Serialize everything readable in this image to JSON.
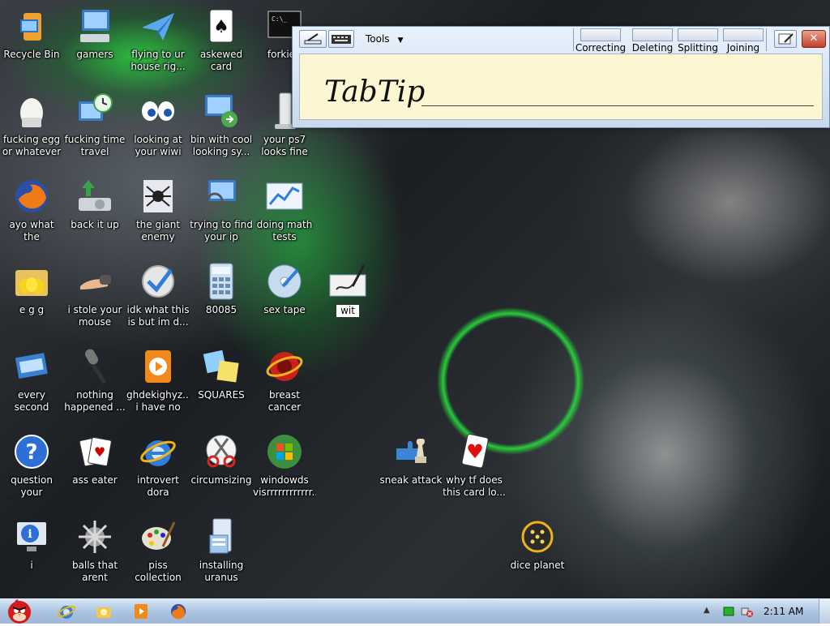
{
  "desktop": {
    "icons": [
      {
        "id": "recycle-bin",
        "label": "Recycle Bin",
        "icon": "recycle-bin-icon"
      },
      {
        "id": "gamers",
        "label": "gamers",
        "icon": "monitor-keyboard-icon"
      },
      {
        "id": "flying",
        "label": "flying to ur\nhouse rig...",
        "icon": "paper-plane-icon"
      },
      {
        "id": "askewed-card",
        "label": "askewed card\nhumping t...",
        "icon": "spade-card-icon"
      },
      {
        "id": "forkie",
        "label": "forkie f",
        "icon": "command-prompt-icon"
      },
      {
        "id": "egg",
        "label": "fucking egg\nor whatever",
        "icon": "egg-icon"
      },
      {
        "id": "time-travel",
        "label": "fucking time\ntravel",
        "icon": "clock-monitor-icon"
      },
      {
        "id": "wiwi",
        "label": "looking at\nyour wiwi",
        "icon": "eyes-icon"
      },
      {
        "id": "bin-cool",
        "label": "bin with cool\nlooking sy...",
        "icon": "network-monitor-icon"
      },
      {
        "id": "ps7",
        "label": "your ps7\nlooks fine",
        "icon": "console-icon"
      },
      {
        "id": "fox",
        "label": "ayo what the\nfox doing t...",
        "icon": "firefox-icon"
      },
      {
        "id": "back-it-up",
        "label": "back it up",
        "icon": "backup-icon"
      },
      {
        "id": "spider",
        "label": "the giant\nenemy spider",
        "icon": "spider-icon"
      },
      {
        "id": "ip",
        "label": "trying to find\nyour ip adress",
        "icon": "search-monitor-icon"
      },
      {
        "id": "math",
        "label": "doing math\ntests",
        "icon": "chart-icon"
      },
      {
        "id": "e-g-g",
        "label": "e g g",
        "icon": "folder-eggs-icon"
      },
      {
        "id": "mouse",
        "label": "i stole your\nmouse",
        "icon": "hand-icon"
      },
      {
        "id": "idk",
        "label": "idk what this\nis but im d...",
        "icon": "checkmark-clock-icon"
      },
      {
        "id": "80085",
        "label": "80085",
        "icon": "calculator-icon"
      },
      {
        "id": "sex-tape",
        "label": "sex tape",
        "icon": "dvd-icon"
      },
      {
        "id": "wit",
        "label": "wit",
        "icon": "pen-tablet-icon",
        "renaming": true
      },
      {
        "id": "every-second",
        "label": "every second\nyour not ru...",
        "icon": "window-icon"
      },
      {
        "id": "nothing",
        "label": "nothing\nhappened ...",
        "icon": "microphone-icon"
      },
      {
        "id": "ghdek",
        "label": "ghdekighyz...\ni have no id...",
        "icon": "media-player-icon"
      },
      {
        "id": "squares",
        "label": "SQUARES",
        "icon": "sticky-notes-icon"
      },
      {
        "id": "breast-cancer",
        "label": "breast cancer\ndiego",
        "icon": "ring-logo-icon"
      },
      {
        "id": "question",
        "label": "question your\nlife choices",
        "icon": "help-icon"
      },
      {
        "id": "ass-eater",
        "label": "ass eater",
        "icon": "cards-icon"
      },
      {
        "id": "dora",
        "label": "introvert dora\nthe explorer",
        "icon": "internet-explorer-icon"
      },
      {
        "id": "circumsizing",
        "label": "circumsizing",
        "icon": "scissors-icon"
      },
      {
        "id": "windowds",
        "label": "windowds\nvisrrrrrrrrrrrr...",
        "icon": "windows-orb-icon"
      },
      {
        "id": "i",
        "label": "i",
        "icon": "info-monitor-icon"
      },
      {
        "id": "balls",
        "label": "balls that\narent shaved",
        "icon": "spiked-ball-icon"
      },
      {
        "id": "piss",
        "label": "piss\ncollection",
        "icon": "palette-icon"
      },
      {
        "id": "uranus",
        "label": "installing\nuranus",
        "icon": "installer-icon"
      },
      {
        "id": "sneak-attack",
        "label": "sneak attack",
        "icon": "chess-puzzle-icon"
      },
      {
        "id": "why-tf",
        "label": "why tf does\nthis card lo...",
        "icon": "heart-card-icon"
      },
      {
        "id": "dice-planet",
        "label": "dice planet",
        "icon": "dice-icon"
      }
    ]
  },
  "tabtip": {
    "tools_label": "Tools",
    "ink_text": "TabTip",
    "gestures": [
      {
        "label": "Correcting"
      },
      {
        "label": "Deleting"
      },
      {
        "label": "Splitting"
      },
      {
        "label": "Joining"
      }
    ],
    "close_symbol": "✕"
  },
  "taskbar": {
    "pinned": [
      "internet-explorer-icon",
      "explorer-icon",
      "media-player-icon",
      "firefox-icon"
    ],
    "clock": "2:11 AM"
  }
}
